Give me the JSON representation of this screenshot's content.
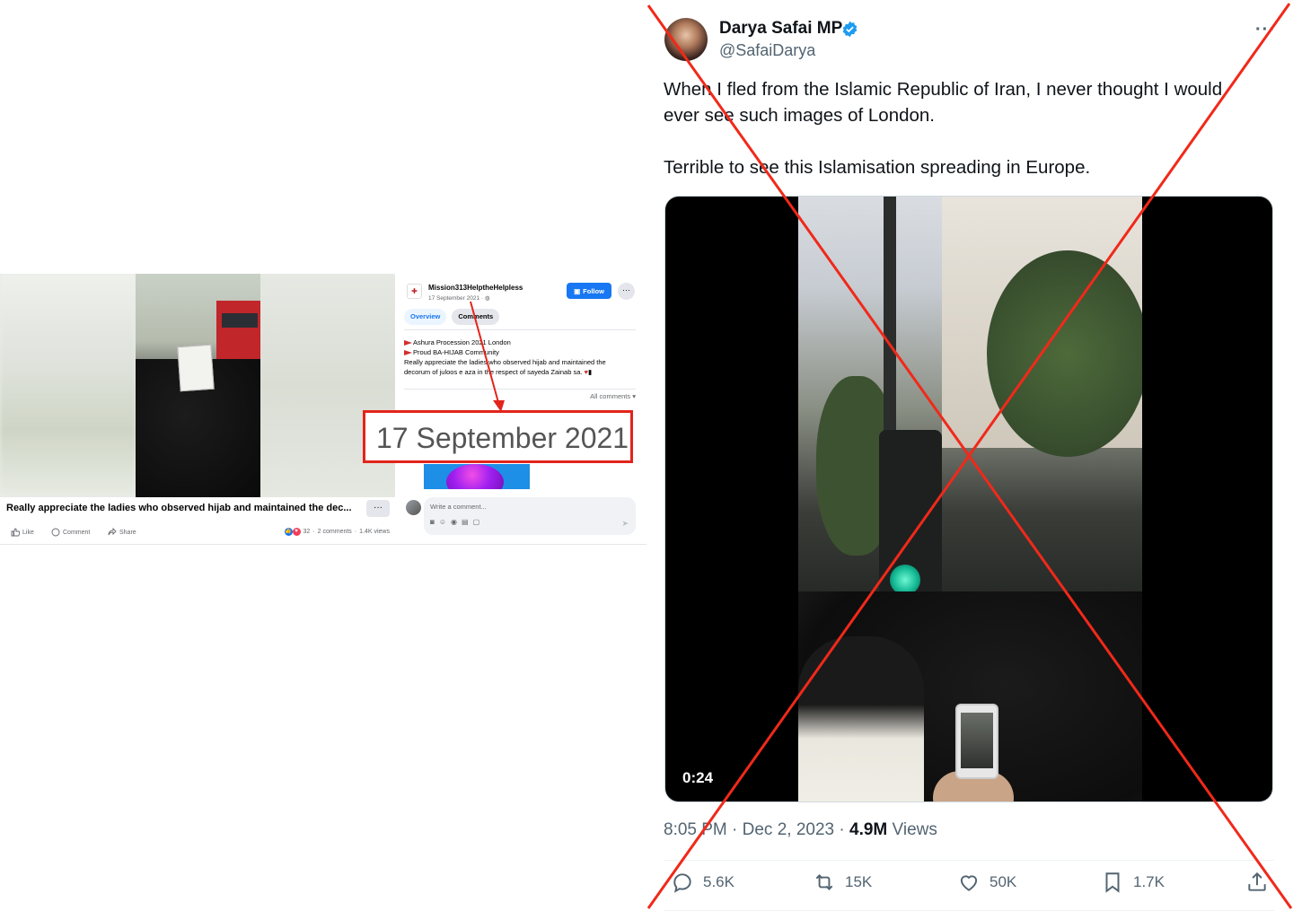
{
  "facebook": {
    "caption": "Really appreciate the ladies who observed hijab and maintained the dec...",
    "caption_more": "···",
    "actions": {
      "like": "Like",
      "comment": "Comment",
      "share": "Share"
    },
    "stats": {
      "reactions": "32",
      "comments": "2 comments",
      "views": "1.4K views"
    },
    "page_name": "Mission313HelptheHelpless",
    "post_date": "17 September 2021 ·",
    "follow_label": "Follow",
    "more_label": "···",
    "tabs": [
      "Overview",
      "Comments"
    ],
    "post_lines": [
      "Ashura Procession 2021 London",
      "Proud BA-HIJAB Community",
      "Really appreciate the ladies who observed hijab and maintained the",
      "decorum of juloos e aza in the respect of sayeda Zainab sa."
    ],
    "all_comments_label": "All comments",
    "comment_placeholder": "Write a comment..."
  },
  "callout": {
    "date_text": "17 September 2021",
    "color": "#e3241b"
  },
  "tweet": {
    "name": "Darya Safai MP",
    "handle": "@SafaiDarya",
    "more_label": "···",
    "text_line1": "When I fled from the Islamic Republic of Iran, I never thought I would",
    "text_line2": "ever see such images of London.",
    "text_line3": "Terrible to see this Islamisation spreading in Europe.",
    "video_duration": "0:24",
    "time": "8:05 PM · Dec 2, 2023 ·",
    "views_count": "4.9M",
    "views_label": "Views",
    "replies": "5.6K",
    "retweets": "15K",
    "likes": "50K",
    "bookmarks": "1.7K",
    "verified_color": "#1d9bf0",
    "text_color": "#0f1419",
    "muted_color": "#536471"
  },
  "overlay": {
    "x_color": "#f0291a"
  }
}
